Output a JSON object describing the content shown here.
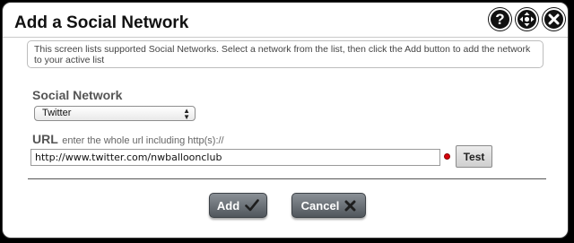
{
  "dialog": {
    "title": "Add a Social Network",
    "header_icons": [
      "help-icon",
      "move-icon",
      "close-icon"
    ],
    "help_glyph": "?"
  },
  "info_text": "This screen lists supported Social Networks. Select a network from the list, then click the Add button to add the network to your active list",
  "network": {
    "label": "Social Network",
    "selected": "Twitter"
  },
  "url": {
    "label": "URL",
    "hint": "enter the whole url including http(s)://",
    "value": "http://www.twitter.com/nwballoonclub",
    "status_color": "#d8000c"
  },
  "buttons": {
    "test": "Test",
    "add": "Add",
    "cancel": "Cancel"
  },
  "colors": {
    "button_dark": "#50565c",
    "button_light": "#8a9096"
  }
}
